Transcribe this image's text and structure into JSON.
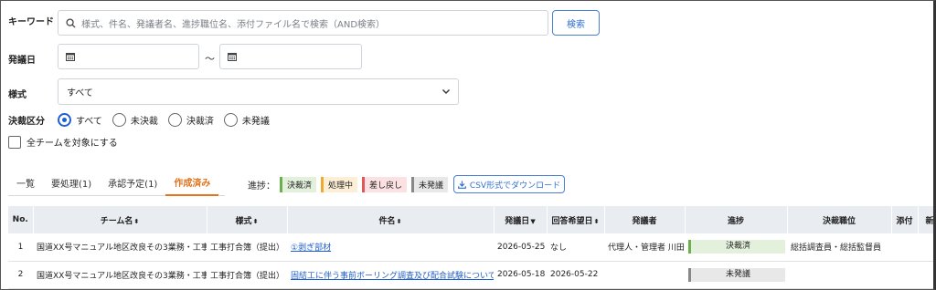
{
  "search": {
    "keyword_label": "キーワード",
    "keyword_placeholder": "様式、件名、発議者名、進捗職位名、添付ファイル名で検索（AND検索）",
    "search_button": "検索",
    "date_label": "発議日",
    "date_separator": "〜",
    "style_label": "様式",
    "style_value": "すべて",
    "decision_label": "決裁区分",
    "decision_options": [
      "すべて",
      "未決裁",
      "決裁済",
      "未発議"
    ],
    "decision_selected": "すべて",
    "all_teams_label": "全チームを対象にする"
  },
  "tabs": [
    {
      "label": "一覧"
    },
    {
      "label": "要処理(1)"
    },
    {
      "label": "承認予定(1)"
    },
    {
      "label": "作成済み"
    }
  ],
  "active_tab": "作成済み",
  "progress_legend": {
    "label": "進捗：",
    "items": [
      "決裁済",
      "処理中",
      "差し戻し",
      "未発議"
    ]
  },
  "csv_button": "CSV形式でダウンロード",
  "table": {
    "headers": {
      "no": "No.",
      "team": "チーム名",
      "style": "様式",
      "subject": "件名",
      "date": "発議日",
      "reply": "回答希望日",
      "proposer": "発議者",
      "progress": "進捗",
      "position": "決裁職位",
      "attach": "添付",
      "new": "新規"
    },
    "rows": [
      {
        "no": "1",
        "team": "国道XX号マニュアル地区改良その3業務・工事",
        "style": "工事打合簿（提出）",
        "subject": "①剥ぎ部材",
        "date": "2026-05-25",
        "reply": "なし",
        "proposer": "代理人・管理者 川田",
        "progress": "決裁済",
        "position": "総括調査員・総括監督員"
      },
      {
        "no": "2",
        "team": "国道XX号マニュアル地区改良その3業務・工事",
        "style": "工事打合簿（提出）",
        "subject": "固結工に伴う事前ボーリング調査及び配合試験について",
        "date": "2026-05-18",
        "reply": "2026-05-22",
        "proposer": "",
        "progress": "未発議",
        "position": ""
      }
    ]
  }
}
